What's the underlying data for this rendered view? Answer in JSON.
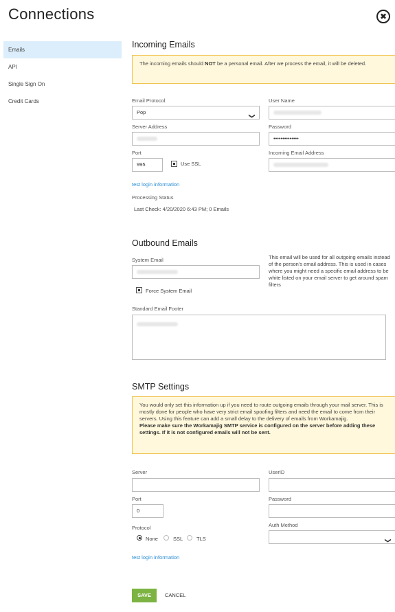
{
  "page": {
    "title": "Connections",
    "close_icon": "✖"
  },
  "sidebar": {
    "items": [
      {
        "label": "Emails"
      },
      {
        "label": "API"
      },
      {
        "label": "Single Sign On"
      },
      {
        "label": "Credit Cards"
      }
    ]
  },
  "incoming": {
    "heading": "Incoming Emails",
    "note_prefix": "The incoming emails should ",
    "note_bold": "NOT",
    "note_suffix": " be a personal email. After we process the email, it will be deleted.",
    "email_protocol_label": "Email Protocol",
    "email_protocol_value": "Pop",
    "user_name_label": "User Name",
    "server_address_label": "Server Address",
    "password_label": "Password",
    "password_value": "••••••••••••••",
    "port_label": "Port",
    "port_value": "995",
    "use_ssl_label": "Use SSL",
    "incoming_address_label": "Incoming Email Address",
    "test_login_link": "test login information",
    "processing_status_label": "Processing Status",
    "last_check": "Last Check:  4/20/2020 6:43 PM;  0 Emails"
  },
  "outbound": {
    "heading": "Outbound Emails",
    "system_email_label": "System Email",
    "help": "This email will be used for all outgoing emails instead of the person's email address. This is used in cases where you might need a specific email address to be white listed on your email server to get around spam filters",
    "force_label": "Force System Email",
    "footer_label": "Standard Email Footer"
  },
  "smtp": {
    "heading": "SMTP Settings",
    "note": "You would only set this information up if you need to route outgoing emails through your mail server. This is mostly done for people who have very strict email spoofing filters and need the email to come from their servers. Using this feature can add a small delay to the delivery of emails from Workamajig.",
    "note_bold": "Please make sure the Workamajig SMTP service is configured on the server before adding these settings. If it is not configured emails will not be sent.",
    "server_label": "Server",
    "userid_label": "UserID",
    "port_label": "Port",
    "port_value": "0",
    "password_label": "Password",
    "protocol_label": "Protocol",
    "protocol_options": [
      "None",
      "SSL",
      "TLS"
    ],
    "auth_method_label": "Auth Method",
    "test_login_link": "test login information"
  },
  "footer": {
    "save_label": "SAVE",
    "cancel_label": "CANCEL"
  },
  "colors": {
    "accent": "#2a8dd4",
    "save": "#7cb342",
    "note_bg": "#fff8dc",
    "note_border": "#f0c24e",
    "sidebar_active": "#dceefb"
  }
}
